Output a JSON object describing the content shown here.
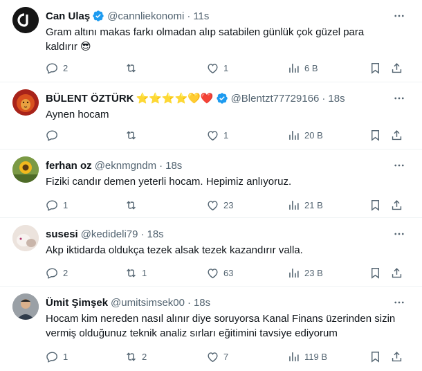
{
  "tweets": [
    {
      "name": "Can Ulaş",
      "handle": "@cannliekonomi",
      "time": "11s",
      "verified": true,
      "text": "Gram altını makas farkı olmadan alıp satabilen günlük çok güzel para kaldırır 😎",
      "replies": "2",
      "retweets": "",
      "likes": "1",
      "views": "6 B",
      "avatar_icon": "cu-logo-avatar"
    },
    {
      "name": "BÜLENT ÖZTÜRK",
      "name_emojis": "⭐⭐⭐⭐💛❤️",
      "handle": "@Blentzt77729166",
      "time": "18s",
      "verified": true,
      "text": "Aynen hocam",
      "replies": "",
      "retweets": "",
      "likes": "1",
      "views": "20 B",
      "avatar_icon": "lion-avatar"
    },
    {
      "name": "ferhan oz",
      "handle": "@eknmgndm",
      "time": "18s",
      "verified": false,
      "text": "Fiziki candır demen yeterli hocam. Hepimiz anlıyoruz.",
      "replies": "1",
      "retweets": "",
      "likes": "23",
      "views": "21 B",
      "avatar_icon": "sunflower-avatar"
    },
    {
      "name": "susesi",
      "handle": "@kedideli79",
      "time": "18s",
      "verified": false,
      "text": "Akp iktidarda oldukça tezek alsak tezek kazandırır valla.",
      "replies": "2",
      "retweets": "1",
      "likes": "63",
      "views": "23 B",
      "avatar_icon": "cat-avatar"
    },
    {
      "name": "Ümit Şimşek",
      "handle": "@umitsimsek00",
      "time": "18s",
      "verified": false,
      "text": "Hocam kim nereden nasıl alınır diye soruyorsa Kanal Finans üzerinden sizin vermiş olduğunuz teknik analiz sırları eğitimini tavsiye ediyorum",
      "replies": "1",
      "retweets": "2",
      "likes": "7",
      "views": "119 B",
      "avatar_icon": "person-avatar"
    }
  ],
  "colors": {
    "muted": "#536471",
    "verified": "#1d9bf0",
    "divider": "#eff3f4",
    "text": "#0f1419"
  },
  "icons": [
    "reply-icon",
    "retweet-icon",
    "like-icon",
    "views-icon",
    "bookmark-icon",
    "share-icon",
    "more-icon",
    "verified-badge-icon"
  ]
}
